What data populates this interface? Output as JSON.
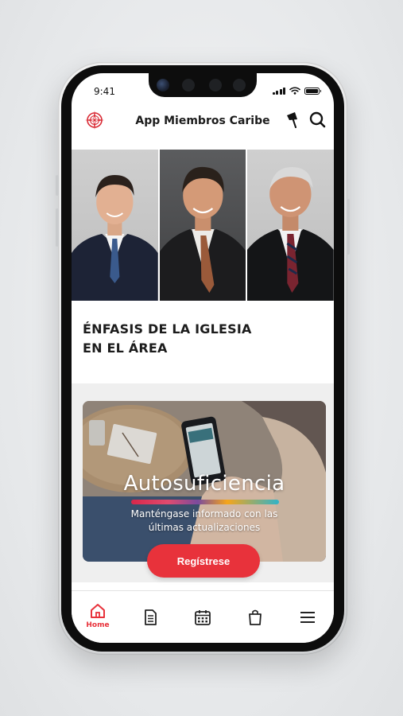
{
  "status_bar": {
    "time": "9:41"
  },
  "header": {
    "title": "App Miembros Caribe",
    "logo_icon": "church-compass-logo",
    "flag_icon": "flag-icon",
    "search_icon": "search-icon"
  },
  "leaders": {
    "photo_count": 3
  },
  "emphasis": {
    "title_line1": "ÉNFASIS DE LA IGLESIA",
    "title_line2": "EN EL ÁREA"
  },
  "banner": {
    "title": "Autosuficiencia",
    "subtitle_line1": "Manténgase informado con las",
    "subtitle_line2": "últimas actualizaciones",
    "button_label": "Regístrese"
  },
  "tabbar": {
    "items": [
      {
        "icon": "home-icon",
        "label": "Home",
        "active": true
      },
      {
        "icon": "document-icon",
        "label": ""
      },
      {
        "icon": "calendar-icon",
        "label": ""
      },
      {
        "icon": "bag-icon",
        "label": ""
      },
      {
        "icon": "menu-icon",
        "label": ""
      }
    ]
  },
  "colors": {
    "accent": "#e8323b",
    "text": "#1c1c1c",
    "section_bg": "#efefef"
  }
}
